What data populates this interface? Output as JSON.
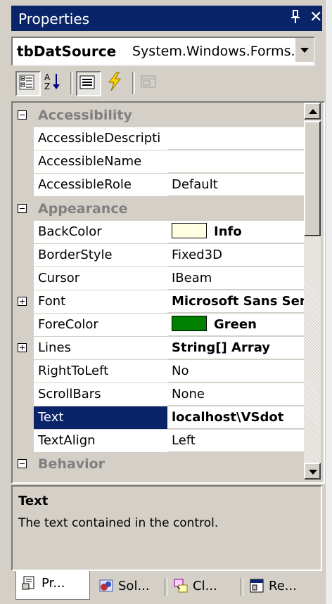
{
  "window": {
    "title": "Properties",
    "pin_glyph": "⊥",
    "close_glyph": "✕"
  },
  "object_selector": {
    "name": "tbDatSource",
    "type": "System.Windows.Forms.TextBox"
  },
  "toolbar": {
    "buttons": [
      {
        "icon": "categorized-icon"
      },
      {
        "icon": "alphabetical-icon"
      },
      {
        "icon": "properties-icon"
      },
      {
        "icon": "events-icon"
      },
      {
        "icon": "property-pages-icon"
      }
    ]
  },
  "grid": {
    "categories": {
      "accessibility": "Accessibility",
      "appearance": "Appearance",
      "behavior": "Behavior"
    },
    "rows": {
      "accessible_description": {
        "label": "AccessibleDescripti",
        "value": ""
      },
      "accessible_name": {
        "label": "AccessibleName",
        "value": ""
      },
      "accessible_role": {
        "label": "AccessibleRole",
        "value": "Default"
      },
      "back_color": {
        "label": "BackColor",
        "value": "Info",
        "color": "#ffffe1"
      },
      "border_style": {
        "label": "BorderStyle",
        "value": "Fixed3D"
      },
      "cursor": {
        "label": "Cursor",
        "value": "IBeam"
      },
      "font": {
        "label": "Font",
        "value": "Microsoft Sans Serif"
      },
      "fore_color": {
        "label": "ForeColor",
        "value": "Green",
        "color": "#008000"
      },
      "lines": {
        "label": "Lines",
        "value": "String[] Array"
      },
      "right_to_left": {
        "label": "RightToLeft",
        "value": "No"
      },
      "scroll_bars": {
        "label": "ScrollBars",
        "value": "None"
      },
      "text": {
        "label": "Text",
        "value": "localhost\\VSdot"
      },
      "text_align": {
        "label": "TextAlign",
        "value": "Left"
      }
    }
  },
  "description": {
    "title": "Text",
    "text": "The text contained in the control."
  },
  "tabs": [
    {
      "label": "Pr...",
      "icon": "properties-tab-icon"
    },
    {
      "label": "Sol...",
      "icon": "solution-explorer-icon"
    },
    {
      "label": "Cl...",
      "icon": "class-view-icon"
    },
    {
      "label": "Re...",
      "icon": "resource-view-icon"
    }
  ],
  "colors": {
    "title_bar": "#0a246a",
    "selection": "#0a246a",
    "category_text": "#808080"
  }
}
